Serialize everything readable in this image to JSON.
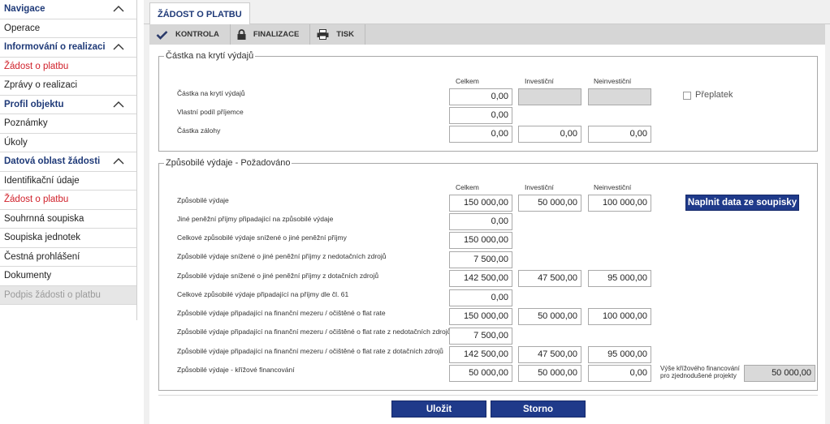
{
  "sidebar": {
    "sections": [
      {
        "title": "Navigace",
        "items": [
          {
            "label": "Operace"
          }
        ]
      },
      {
        "title": "Informování o realizaci",
        "items": [
          {
            "label": "Žádost o platbu"
          },
          {
            "label": "Zprávy o realizaci"
          }
        ]
      },
      {
        "title": "Profil objektu",
        "items": [
          {
            "label": "Poznámky"
          },
          {
            "label": "Úkoly"
          }
        ]
      },
      {
        "title": "Datová oblast žádosti",
        "items": [
          {
            "label": "Identifikační údaje"
          },
          {
            "label": "Žádost o platbu"
          },
          {
            "label": "Souhrnná soupiska"
          },
          {
            "label": "Soupiska jednotek"
          },
          {
            "label": "Čestná prohlášení"
          },
          {
            "label": "Dokumenty"
          },
          {
            "label": "Podpis žádosti o platbu"
          }
        ]
      }
    ]
  },
  "tab": {
    "label": "ŽÁDOST O PLATBU"
  },
  "toolbar": {
    "kontrola": "KONTROLA",
    "finalizace": "FINALIZACE",
    "tisk": "TISK"
  },
  "colors": {
    "accent": "#1f3a8a",
    "active": "#d0202a"
  },
  "section1": {
    "legend": "Částka na krytí výdajů",
    "col_total": "Celkem",
    "col_invest": "Investiční",
    "col_noninvest": "Neinvestiční",
    "rows": [
      {
        "label": "Částka na krytí výdajů",
        "total": "0,00",
        "invest": "",
        "noninvest": ""
      },
      {
        "label": "Vlastní podíl příjemce",
        "total": "0,00"
      },
      {
        "label": "Částka zálohy",
        "total": "0,00",
        "invest": "0,00",
        "noninvest": "0,00"
      }
    ],
    "preplatek": "Přeplatek"
  },
  "section2": {
    "legend": "Způsobilé výdaje - Požadováno",
    "col_total": "Celkem",
    "col_invest": "Investiční",
    "col_noninvest": "Neinvestiční",
    "fill_button": "Naplnit data ze soupisky",
    "rows": [
      {
        "label": "Způsobilé výdaje",
        "total": "150 000,00",
        "invest": "50 000,00",
        "noninvest": "100 000,00"
      },
      {
        "label": "Jiné peněžní příjmy připadající na způsobilé výdaje",
        "total": "0,00"
      },
      {
        "label": "Celkové způsobilé výdaje snížené o jiné peněžní příjmy",
        "total": "150 000,00"
      },
      {
        "label": "Způsobilé výdaje snížené o jiné peněžní příjmy z nedotačních zdrojů",
        "total": "7 500,00"
      },
      {
        "label": "Způsobilé výdaje snížené o jiné peněžní příjmy z dotačních zdrojů",
        "total": "142 500,00",
        "invest": "47 500,00",
        "noninvest": "95 000,00"
      },
      {
        "label": "Celkové způsobilé výdaje připadající na příjmy dle čl. 61",
        "total": "0,00"
      },
      {
        "label": "Způsobilé výdaje připadající na finanční mezeru / očištěné o flat rate",
        "total": "150 000,00",
        "invest": "50 000,00",
        "noninvest": "100 000,00"
      },
      {
        "label": "Způsobilé výdaje připadající na finanční mezeru / očištěné o flat rate z nedotačních zdrojů",
        "total": "7 500,00"
      },
      {
        "label": "Způsobilé výdaje připadající na finanční mezeru / očištěné o flat rate z dotačních zdrojů",
        "total": "142 500,00",
        "invest": "47 500,00",
        "noninvest": "95 000,00"
      },
      {
        "label": "Způsobilé výdaje - křížové financování",
        "total": "50 000,00",
        "invest": "50 000,00",
        "noninvest": "0,00"
      }
    ],
    "cross_label_line1": "Výše křížového financování",
    "cross_label_line2": "pro zjednodušené projekty",
    "cross_value": "50 000,00"
  },
  "buttons": {
    "save": "Uložit",
    "cancel": "Storno"
  }
}
